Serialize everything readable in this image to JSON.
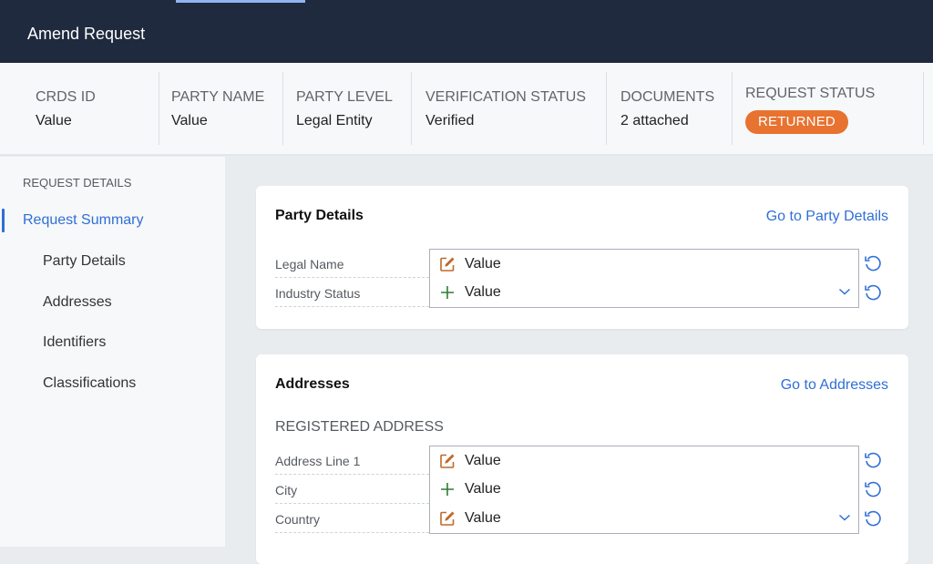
{
  "header": {
    "title": "Amend Request"
  },
  "summary": {
    "fields": [
      {
        "label": "CRDS ID",
        "value": "Value"
      },
      {
        "label": "PARTY NAME",
        "value": "Value"
      },
      {
        "label": "PARTY LEVEL",
        "value": "Legal Entity"
      },
      {
        "label": "VERIFICATION STATUS",
        "value": "Verified"
      },
      {
        "label": "DOCUMENTS",
        "value": "2 attached"
      }
    ],
    "request_status": {
      "label": "REQUEST STATUS",
      "badge": "RETURNED",
      "badge_color": "#e8722f"
    }
  },
  "sidebar": {
    "heading": "REQUEST DETAILS",
    "items": [
      {
        "label": "Request Summary",
        "active": true
      },
      {
        "label": "Party Details"
      },
      {
        "label": "Addresses"
      },
      {
        "label": "Identifiers"
      },
      {
        "label": "Classifications"
      }
    ]
  },
  "party_details": {
    "title": "Party Details",
    "link": "Go to Party Details",
    "fields": [
      {
        "label": "Legal Name",
        "value": "Value",
        "change_icon": "edit-icon",
        "dropdown": false
      },
      {
        "label": "Industry Status",
        "value": "Value",
        "change_icon": "plus-icon",
        "dropdown": true
      }
    ]
  },
  "addresses": {
    "title": "Addresses",
    "link": "Go to Addresses",
    "subheading": "REGISTERED ADDRESS",
    "fields": [
      {
        "label": "Address Line 1",
        "value": "Value",
        "change_icon": "edit-icon",
        "dropdown": false
      },
      {
        "label": "City",
        "value": "Value",
        "change_icon": "plus-icon",
        "dropdown": false
      },
      {
        "label": "Country",
        "value": "Value",
        "change_icon": "edit-icon",
        "dropdown": true
      }
    ]
  },
  "colors": {
    "accent": "#2f6fd6",
    "header_bg": "#1f2a3e",
    "edit_icon": "#c0692a",
    "add_icon": "#2e7d32"
  }
}
